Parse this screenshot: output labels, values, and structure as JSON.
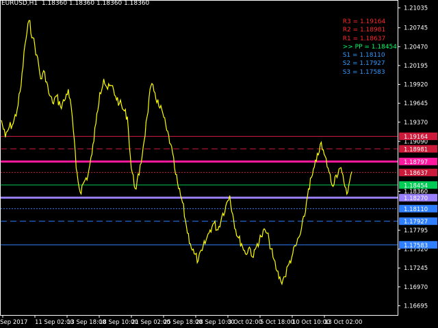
{
  "window": {
    "symbol_line": "EURUSD,H1  1.18360 1.18360 1.18360 1.18360"
  },
  "pivot_panel": [
    {
      "label": "R3 = 1.19164",
      "color": "#ff2a2a"
    },
    {
      "label": "R2 = 1.18981",
      "color": "#ff2a2a"
    },
    {
      "label": "R1 = 1.18637",
      "color": "#ff2a2a"
    },
    {
      "label": ">> PP = 1.18454",
      "color": "#00ff66"
    },
    {
      "label": "S1 = 1.18110",
      "color": "#3399ff"
    },
    {
      "label": "S2 = 1.17927",
      "color": "#3399ff"
    },
    {
      "label": "S3 = 1.17583",
      "color": "#3399ff"
    }
  ],
  "colors": {
    "background": "#000000",
    "price_line": "#ffff00",
    "axis_text": "#ffffff",
    "resistance": "#cc1a3a",
    "pivot": "#00cc55",
    "support": "#2f7fff",
    "magenta": "#ff1aa0",
    "lavender": "#9a80ff"
  },
  "chart_data": {
    "type": "line",
    "title": "EURUSD,H1",
    "ylim": [
      1.1655,
      1.2115
    ],
    "y_ticks": [
      "1.21035",
      "1.20745",
      "1.20470",
      "1.20195",
      "1.19920",
      "1.19645",
      "1.19370",
      "1.19090",
      "1.18360",
      "1.17795",
      "1.17520",
      "1.17245",
      "1.16970",
      "1.16695"
    ],
    "x_ticks": [
      "6 Sep 2017",
      "11 Sep 02:00",
      "13 Sep 18:00",
      "18 Sep 10:00",
      "21 Sep 02:00",
      "25 Sep 18:00",
      "28 Sep 10:00",
      "3 Oct 02:00",
      "5 Oct 18:00",
      "10 Oct 10:00",
      "13 Oct 02:00"
    ],
    "series": [
      {
        "name": "EURUSD",
        "values": [
          1.194,
          1.1915,
          1.193,
          1.1935,
          1.1955,
          1.199,
          1.205,
          1.2085,
          1.206,
          1.2035,
          1.2,
          1.201,
          1.198,
          1.1965,
          1.1975,
          1.196,
          1.1968,
          1.1985,
          1.1945,
          1.187,
          1.1835,
          1.185,
          1.186,
          1.189,
          1.1935,
          1.198,
          1.2,
          1.1985,
          1.199,
          1.1975,
          1.1965,
          1.1955,
          1.1945,
          1.187,
          1.184,
          1.186,
          1.19,
          1.1945,
          1.199,
          1.198,
          1.196,
          1.195,
          1.1925,
          1.1905,
          1.187,
          1.184,
          1.182,
          1.1785,
          1.176,
          1.1745,
          1.1735,
          1.175,
          1.1765,
          1.178,
          1.179,
          1.178,
          1.18,
          1.1815,
          1.183,
          1.1795,
          1.177,
          1.176,
          1.1745,
          1.1755,
          1.174,
          1.176,
          1.177,
          1.178,
          1.1765,
          1.174,
          1.172,
          1.1705,
          1.1712,
          1.173,
          1.1745,
          1.176,
          1.1775,
          1.18,
          1.184,
          1.186,
          1.188,
          1.1905,
          1.189,
          1.187,
          1.1845,
          1.186,
          1.187,
          1.185,
          1.1835,
          1.1865
        ]
      }
    ],
    "hlines": [
      {
        "name": "R3",
        "value": 1.19164,
        "label": "1.19164",
        "style": "solid",
        "color": "#cc1a3a"
      },
      {
        "name": "R2",
        "value": 1.18981,
        "label": "1.18981",
        "style": "dashed",
        "color": "#cc1a3a"
      },
      {
        "name": "magenta",
        "value": 1.18797,
        "label": "1.18797",
        "style": "thick",
        "color": "#ff1aa0"
      },
      {
        "name": "R1",
        "value": 1.18637,
        "label": "1.18637",
        "style": "dotted",
        "color": "#cc1a3a"
      },
      {
        "name": "PP",
        "value": 1.18454,
        "label": "1.18454",
        "style": "solid",
        "color": "#00cc55"
      },
      {
        "name": "lavender",
        "value": 1.1827,
        "label": "1.18270",
        "style": "thick",
        "color": "#9a80ff"
      },
      {
        "name": "S1",
        "value": 1.1811,
        "label": "1.18110",
        "style": "dotted",
        "color": "#2f7fff"
      },
      {
        "name": "S2",
        "value": 1.17927,
        "label": "1.17927",
        "style": "dashed",
        "color": "#2f7fff"
      },
      {
        "name": "S3",
        "value": 1.17583,
        "label": "1.17583",
        "style": "solid",
        "color": "#2f7fff"
      }
    ]
  }
}
